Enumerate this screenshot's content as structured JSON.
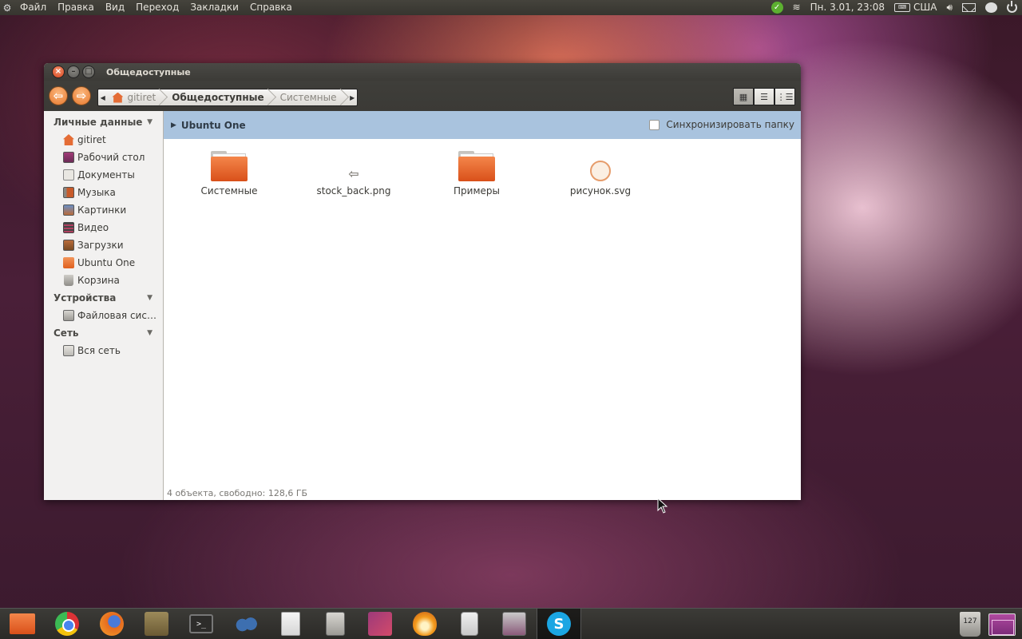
{
  "top_panel": {
    "menus": [
      "Файл",
      "Правка",
      "Вид",
      "Переход",
      "Закладки",
      "Справка"
    ],
    "datetime": "Пн.  3.01, 23:08",
    "keyboard_layout": "США"
  },
  "window": {
    "title": "Общедоступные",
    "breadcrumbs": [
      "gitiret",
      "Общедоступные",
      "Системные"
    ],
    "active_crumb_index": 1
  },
  "sidebar": {
    "personal": {
      "title": "Личные данные",
      "items": [
        "gitiret",
        "Рабочий стол",
        "Документы",
        "Музыка",
        "Картинки",
        "Видео",
        "Загрузки",
        "Ubuntu One",
        "Корзина"
      ]
    },
    "devices": {
      "title": "Устройства",
      "items": [
        "Файловая сис…"
      ]
    },
    "network": {
      "title": "Сеть",
      "items": [
        "Вся сеть"
      ]
    }
  },
  "ubuntu_one": {
    "label": "Ubuntu One",
    "sync_label": "Синхронизировать папку",
    "sync_checked": false
  },
  "files": [
    {
      "name": "Системные",
      "type": "folder"
    },
    {
      "name": "stock_back.png",
      "type": "image-back"
    },
    {
      "name": "Примеры",
      "type": "folder"
    },
    {
      "name": "рисунок.svg",
      "type": "svg"
    }
  ],
  "status": "4 объекта, свободно: 128,6 ГБ",
  "dock": {
    "apps": [
      "home-folder",
      "chrome",
      "firefox",
      "archive",
      "terminal",
      "gnome-foot",
      "text-editor",
      "calculator",
      "impress",
      "brasero",
      "speaker",
      "screenshot",
      "skype"
    ],
    "active_app": "skype",
    "trash_count": "127"
  },
  "colors": {
    "accent_orange": "#e7772c",
    "selection_blue": "#a9c3de",
    "panel_dark": "#3c3b37"
  }
}
